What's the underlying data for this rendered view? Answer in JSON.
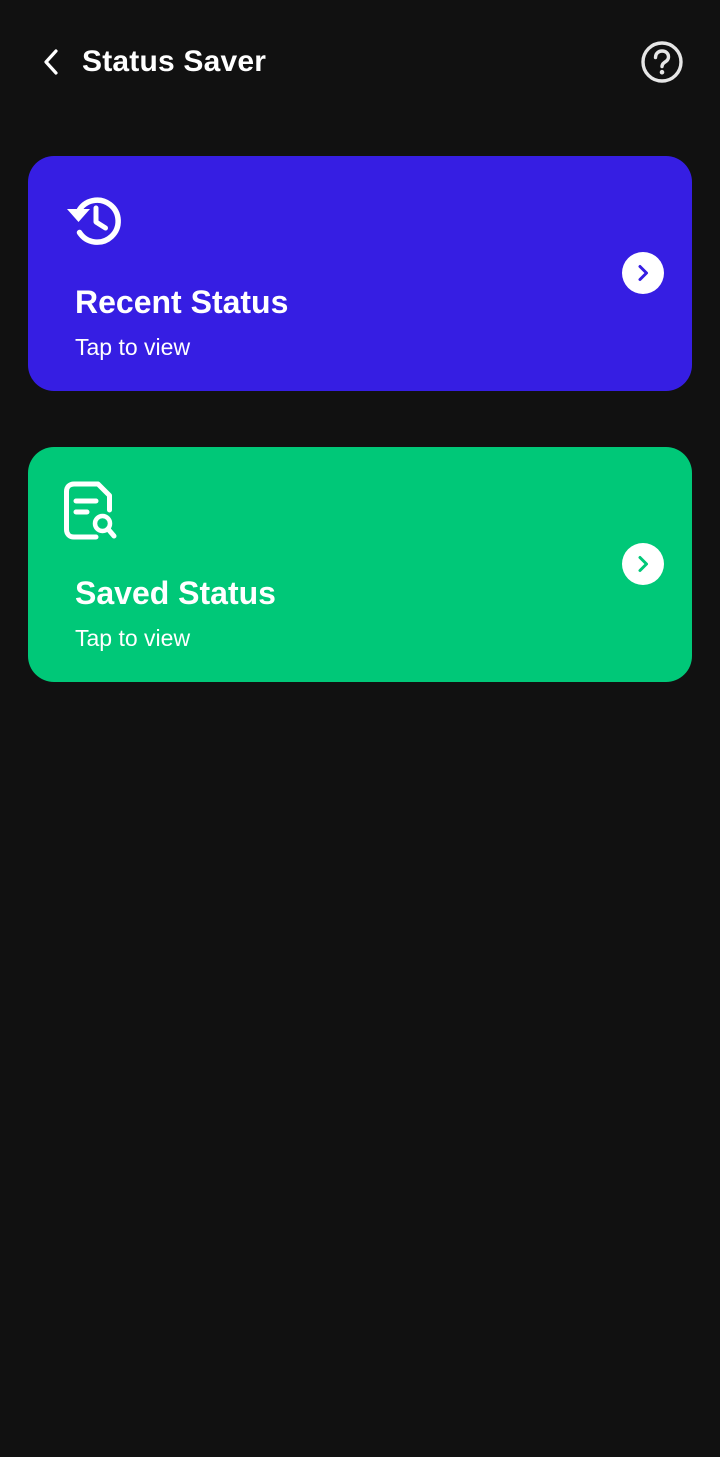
{
  "app": {
    "title": "Status Saver",
    "background_color": "#111111"
  },
  "header": {
    "back_icon": "chevron-left-icon",
    "help_icon": "help-circle-icon"
  },
  "cards": [
    {
      "title": "Recent Status",
      "subtitle": "Tap to view",
      "icon": "history-icon",
      "color": "#361EE3",
      "arrow_icon": "chevron-right-icon"
    },
    {
      "title": "Saved Status",
      "subtitle": "Tap to view",
      "icon": "document-search-icon",
      "color": "#00C878",
      "arrow_icon": "chevron-right-icon"
    }
  ]
}
